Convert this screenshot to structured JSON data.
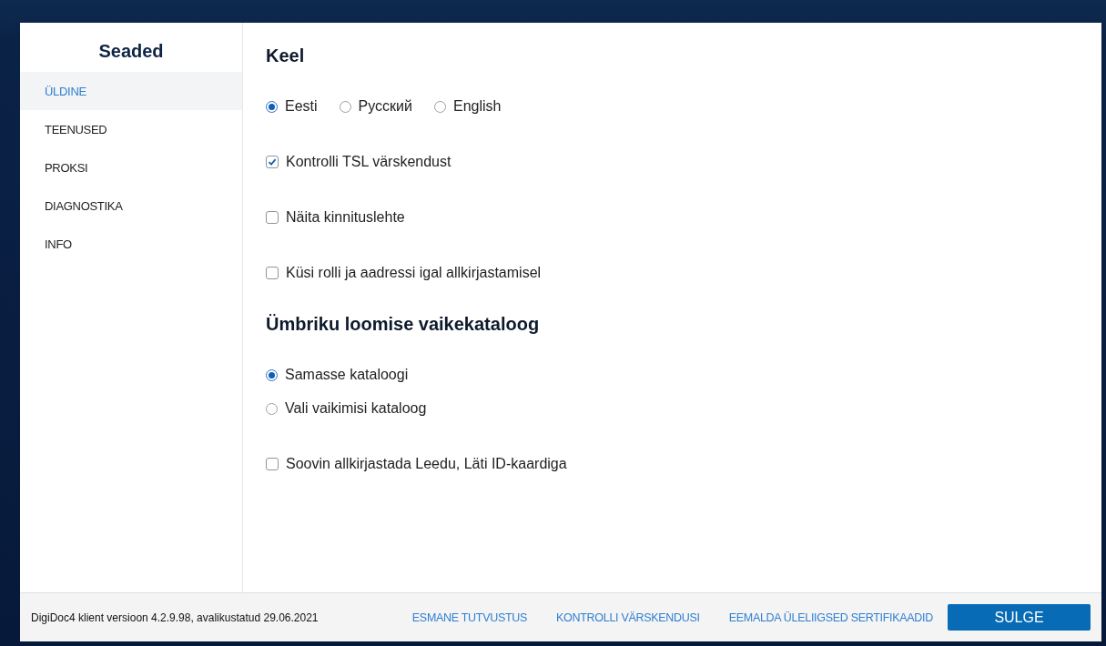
{
  "sidebar": {
    "title": "Seaded",
    "items": [
      {
        "label": "ÜLDINE",
        "selected": true
      },
      {
        "label": "TEENUSED",
        "selected": false
      },
      {
        "label": "PROKSI",
        "selected": false
      },
      {
        "label": "DIAGNOSTIKA",
        "selected": false
      },
      {
        "label": "INFO",
        "selected": false
      }
    ]
  },
  "content": {
    "blocks": [
      {
        "kind": "heading",
        "text": "Keel"
      },
      {
        "kind": "radio_row",
        "options": [
          {
            "label": "Eesti",
            "selected": true
          },
          {
            "label": "Русский",
            "selected": false
          },
          {
            "label": "English",
            "selected": false
          }
        ]
      },
      {
        "kind": "checkbox",
        "label": "Kontrolli TSL värskendust",
        "checked": true
      },
      {
        "kind": "checkbox",
        "label": "Näita kinnituslehte",
        "checked": false
      },
      {
        "kind": "checkbox",
        "label": "Küsi rolli ja aadressi igal allkirjastamisel",
        "checked": false
      },
      {
        "kind": "heading",
        "text": "Ümbriku loomise vaikekataloog"
      },
      {
        "kind": "radio_column",
        "options": [
          {
            "label": "Samasse kataloogi",
            "selected": true
          },
          {
            "label": "Vali vaikimisi kataloog",
            "selected": false
          }
        ]
      },
      {
        "kind": "checkbox",
        "label": "Soovin allkirjastada Leedu, Läti ID-kaardiga",
        "checked": false
      }
    ]
  },
  "footer": {
    "version": "DigiDoc4 klient versioon 4.2.9.98, avalikustatud 29.06.2021",
    "links": [
      "ESMANE TUTVUSTUS",
      "KONTROLLI VÄRSKENDUSI",
      "EEMALDA ÜLELIIGSED SERTIFIKAADID"
    ],
    "close_button": "SULGE"
  }
}
